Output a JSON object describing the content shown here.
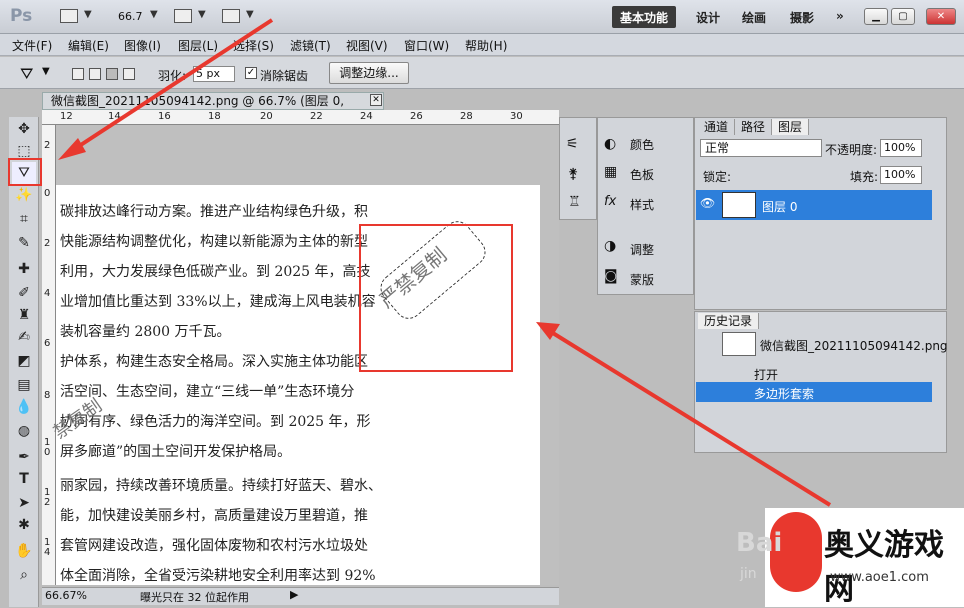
{
  "app": {
    "logo": "Ps",
    "zoom": "66.7"
  },
  "workspaces": [
    "基本功能",
    "设计",
    "绘画",
    "摄影",
    "»"
  ],
  "menus": [
    "文件(F)",
    "编辑(E)",
    "图像(I)",
    "图层(L)",
    "选择(S)",
    "滤镜(T)",
    "视图(V)",
    "窗口(W)",
    "帮助(H)"
  ],
  "options": {
    "feather_label": "羽化:",
    "feather_value": "5 px",
    "antialias_label": "消除锯齿",
    "refine_label": "调整边缘..."
  },
  "document": {
    "tab_title": "微信截图_20211105094142.png @ 66.7% (图层 0, RGB/8)",
    "ruler_h": [
      "12",
      "14",
      "16",
      "18",
      "20",
      "22",
      "24",
      "26",
      "28",
      "30"
    ],
    "ruler_v": [
      "2",
      "0",
      "2",
      "4",
      "6",
      "8",
      "1 0",
      "1 2",
      "1 4",
      "1 6",
      "1 8",
      "2 0"
    ],
    "lines": [
      "碳排放达峰行动方案。推进产业结构绿色升级，积",
      "快能源结构调整优化，构建以新能源为主体的新型",
      "利用，大力发展绿色低碳产业。到 2025 年，高技",
      "业增加值比重达到 33%以上，建成海上风电装机容",
      "装机容量约 2800 万千瓦。",
      "护体系，构建生态安全格局。深入实施主体功能区",
      "活空间、生态空间，建立“三线一单”生态环境分",
      "协同有序、绿色活力的海洋空间。到 2025 年，形",
      "屏多廊道”的国土空间开发保护格局。",
      "丽家园，持续改善环境质量。持续打好蓝天、碧水、",
      "能，加快建设美丽乡村，高质量建设万里碧道，推",
      "套管网建设改造，强化固体废物和农村污水垃圾处",
      "体全面消除，全省受污染耕地安全利用率达到 92%"
    ],
    "watermark": "严禁复制",
    "watermark2": "禁复制"
  },
  "status": {
    "zoom": "66.67%",
    "message": "曝光只在 32 位起作用"
  },
  "mini_panels": {
    "items": [
      "颜色",
      "色板",
      "样式",
      "调整",
      "蒙版"
    ]
  },
  "layers": {
    "tabs": [
      "通道",
      "路径",
      "图层"
    ],
    "blend_mode": "正常",
    "opacity_label": "不透明度:",
    "opacity_value": "100%",
    "lock_label": "锁定:",
    "fill_label": "填充:",
    "fill_value": "100%",
    "layer_name": "图层 0"
  },
  "history": {
    "tab": "历史记录",
    "snapshot": "微信截图_20211105094142.png",
    "items": [
      "打开",
      "多边形套索"
    ]
  },
  "brand": {
    "name": "奥义游戏网",
    "url": "www.aoe1.com",
    "baidu": "Bai",
    "jingyan": "jin"
  },
  "colors": {
    "accent": "#e8382e",
    "selection": "#2d7fdb"
  }
}
